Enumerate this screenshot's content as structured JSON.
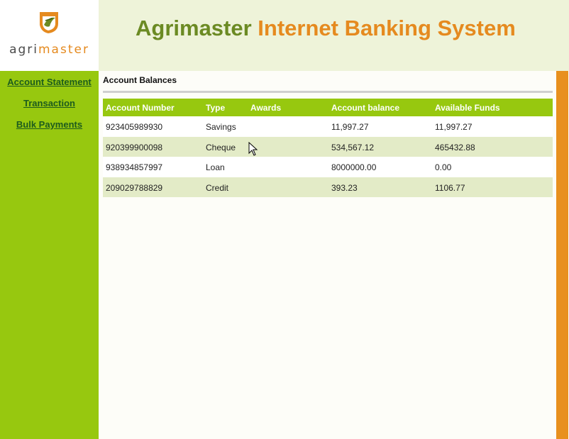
{
  "brand": {
    "logo_text_a": "agri",
    "logo_text_b": "master",
    "title_part_1": "Agri",
    "title_part_2": "master",
    "title_part_3": " Internet Banking System",
    "colors": {
      "green": "#97c80f",
      "dark_green": "#6b8a23",
      "orange": "#e58a1f"
    }
  },
  "sidebar": {
    "items": [
      {
        "label": "Account Statement"
      },
      {
        "label": "Transaction"
      },
      {
        "label": "Bulk Payments"
      }
    ]
  },
  "main": {
    "section_title": "Account Balances",
    "columns": [
      "Account Number",
      "Type",
      "Awards",
      "Account balance",
      "Available Funds"
    ],
    "rows": [
      {
        "account_number": "923405989930",
        "type": "Savings",
        "awards": "",
        "balance": "11,997.27",
        "available": "11,997.27"
      },
      {
        "account_number": "920399900098",
        "type": "Cheque",
        "awards": "",
        "balance": "534,567.12",
        "available": "465432.88"
      },
      {
        "account_number": "938934857997",
        "type": "Loan",
        "awards": "",
        "balance": "8000000.00",
        "available": "0.00"
      },
      {
        "account_number": "209029788829",
        "type": "Credit",
        "awards": "",
        "balance": "393.23",
        "available": "1106.77"
      }
    ]
  }
}
